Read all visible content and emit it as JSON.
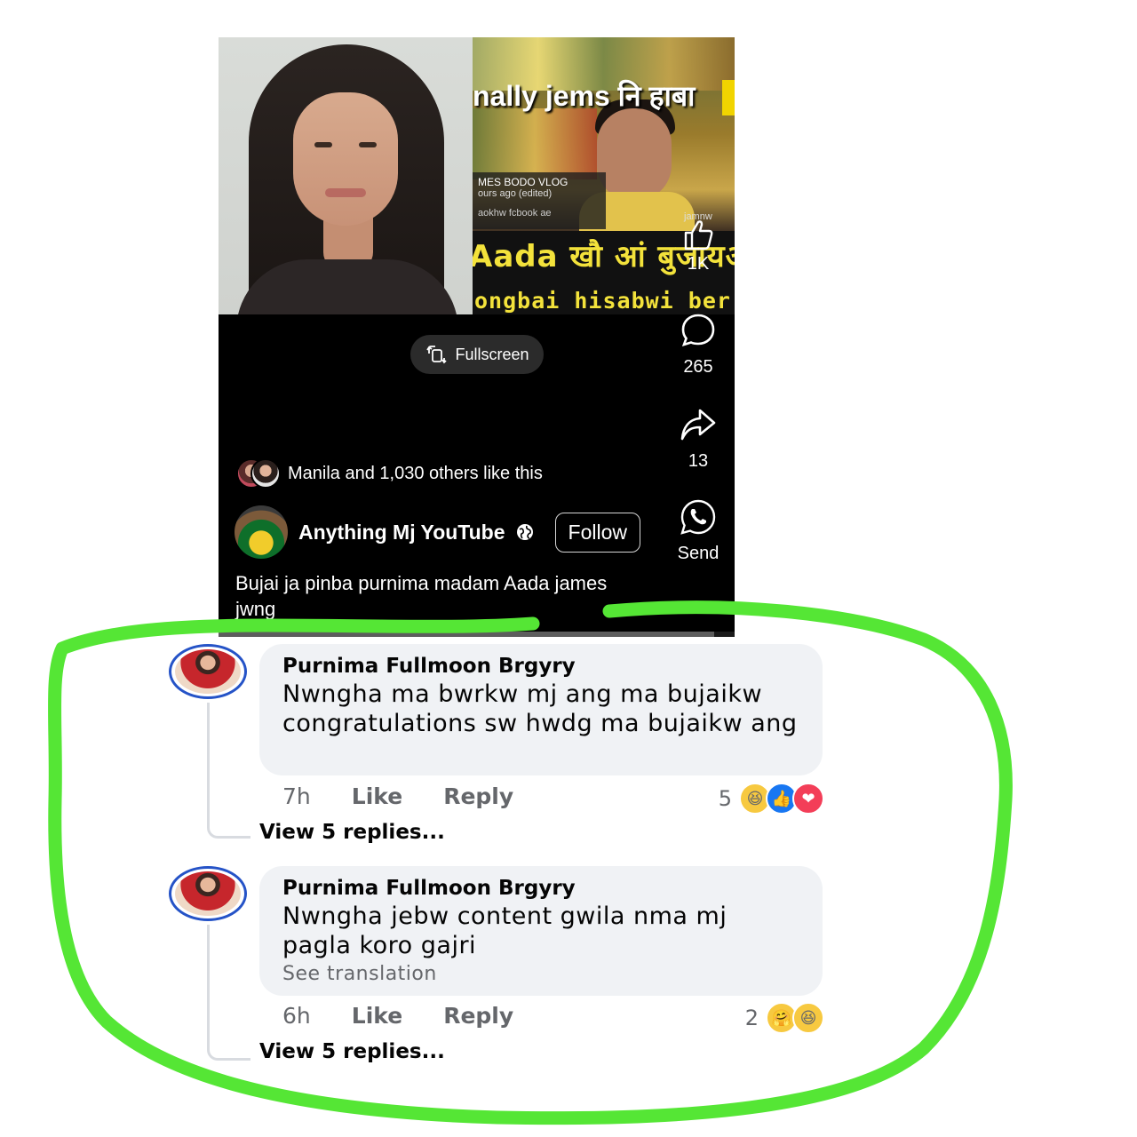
{
  "reel": {
    "thumbnail": {
      "title": "nally jems नि हाबा",
      "channel": "MES BODO VLOG",
      "time": "ours ago (edited)",
      "cut_text": "aokhw fcbook ae",
      "corner": "jamnw",
      "line1": "Aada खौ आं बुजायअ",
      "line2": "ongbai hisabwi ber"
    },
    "fullscreen_label": "Fullscreen",
    "actions": {
      "like_count": "1K",
      "comment_count": "265",
      "share_count": "13",
      "send_label": "Send"
    },
    "liked_by": "Manila and 1,030 others like this",
    "author": {
      "name": "Anything Mj YouTube",
      "follow_label": "Follow"
    },
    "caption": "Bujai ja pinba purnima madam Aada james jwng",
    "progress": 0.96
  },
  "comments": [
    {
      "name": "Purnima Fullmoon Brgyry",
      "text": "Nwngha ma bwrkw mj ang ma bujaikw congratulations sw hwdg ma bujaikw ang",
      "translation": "",
      "time": "7h",
      "like_label": "Like",
      "reply_label": "Reply",
      "reaction_count": "5",
      "reactions": [
        "haha",
        "like",
        "love"
      ],
      "view_replies": "View 5 replies..."
    },
    {
      "name": "Purnima Fullmoon Brgyry",
      "text": "Nwngha jebw content gwila nma mj pagla koro gajri",
      "translation": "See translation",
      "time": "6h",
      "like_label": "Like",
      "reply_label": "Reply",
      "reaction_count": "2",
      "reactions": [
        "care",
        "haha"
      ],
      "view_replies": "View 5 replies..."
    }
  ],
  "colors": {
    "highlight": "#55e635",
    "bubble": "#f0f2f5",
    "avatar_ring": "#2553c7"
  }
}
